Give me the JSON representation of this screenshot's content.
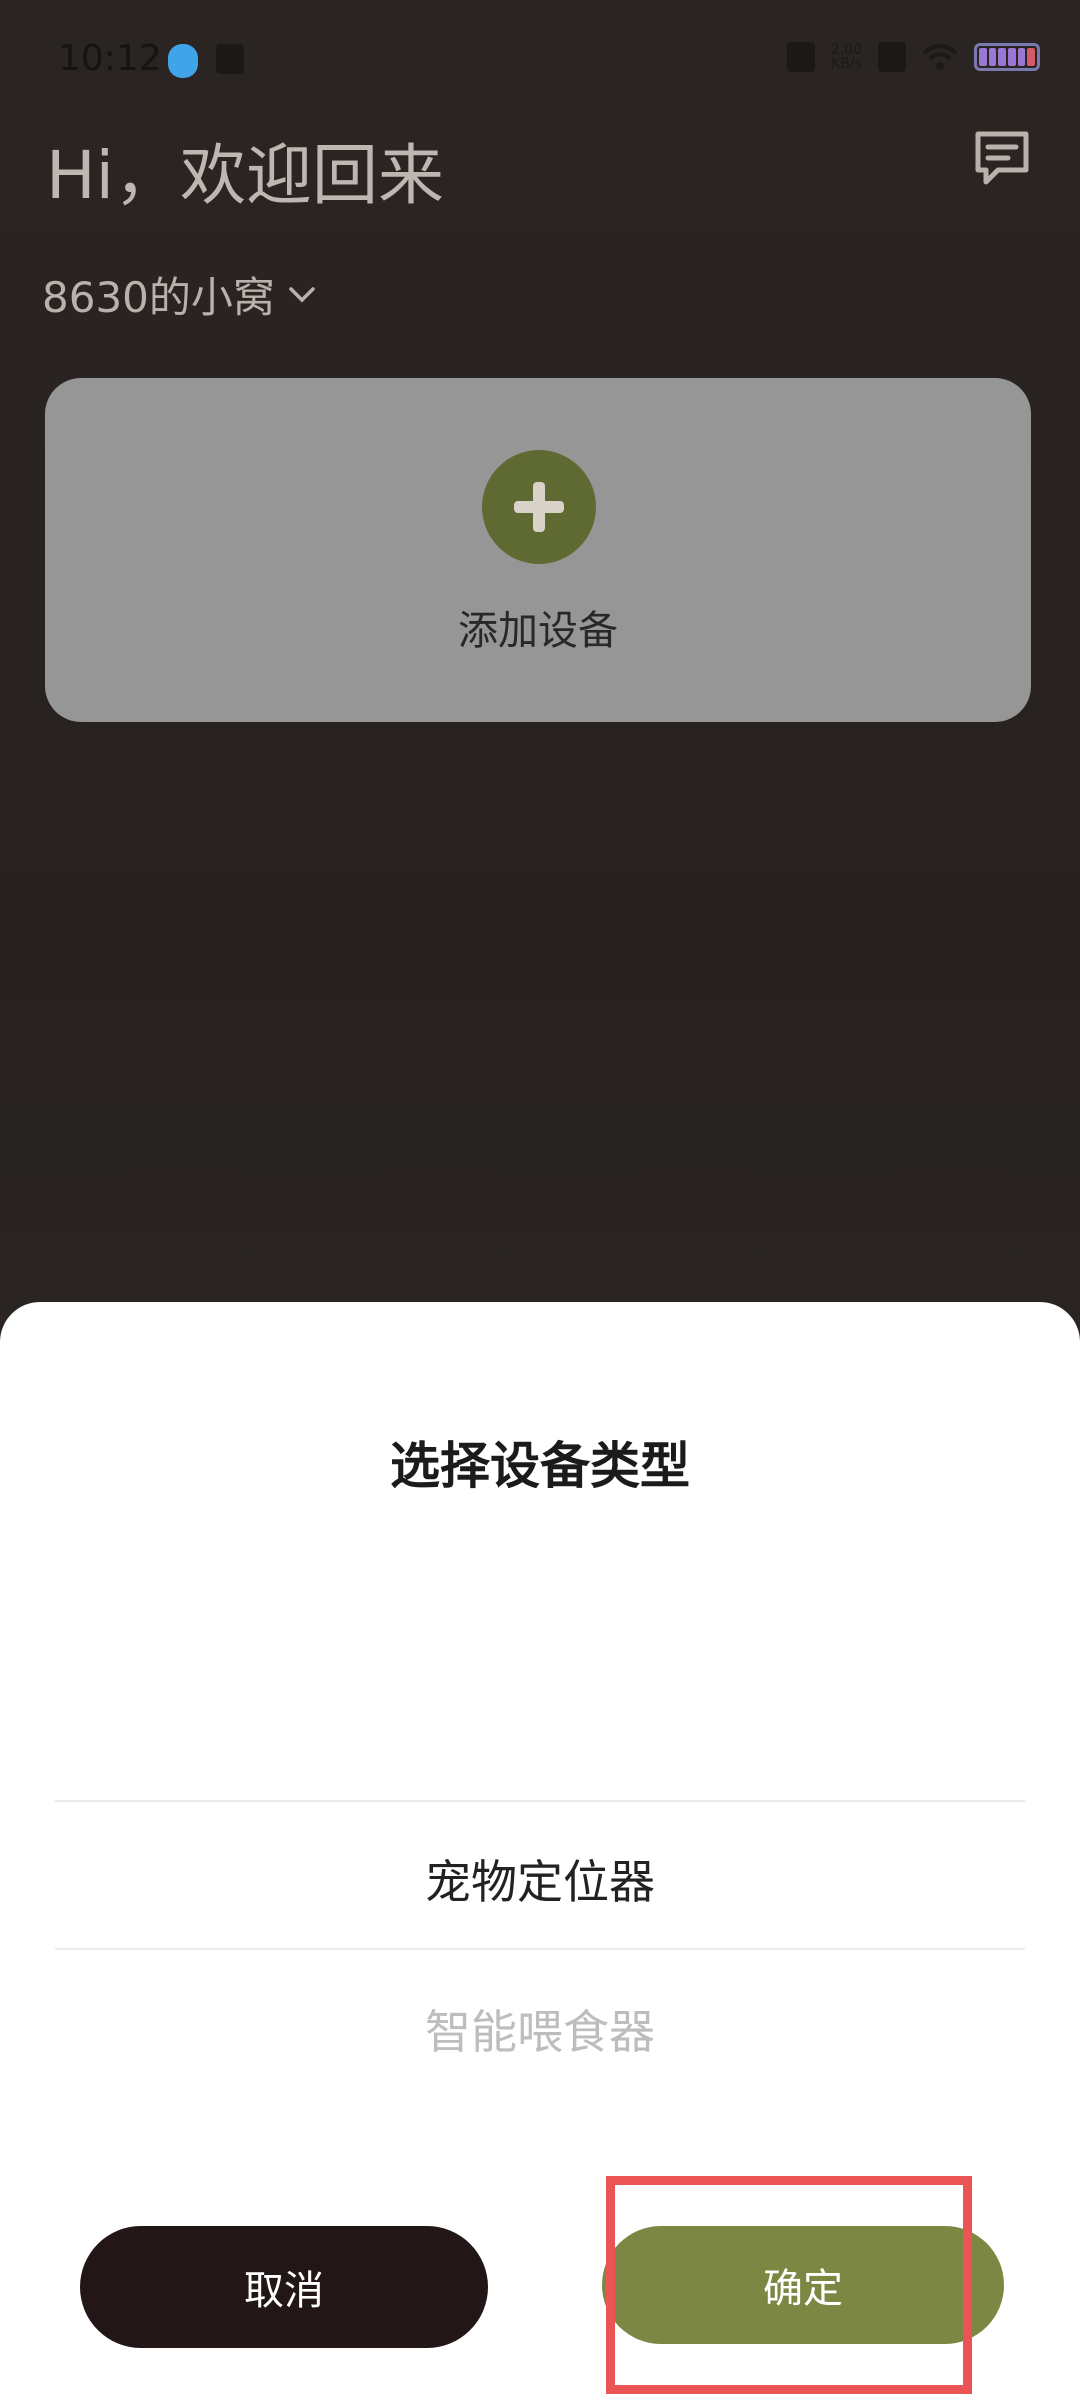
{
  "status_bar": {
    "time": "10:12",
    "net_speed_value": "2.00",
    "net_speed_unit": "KB/s"
  },
  "header": {
    "greeting": "Hi，欢迎回来",
    "home_name": "8630的小窝"
  },
  "add_device_card": {
    "label": "添加设备"
  },
  "sheet": {
    "title": "选择设备类型",
    "options": [
      "宠物定位器",
      "智能喂食器"
    ],
    "selected_index": 0,
    "cancel_label": "取消",
    "confirm_label": "确定"
  },
  "colors": {
    "accent_olive": "#7b8742",
    "add_button": "#5e6a31",
    "cancel_button": "#221617",
    "highlight_box": "#ea5455"
  }
}
